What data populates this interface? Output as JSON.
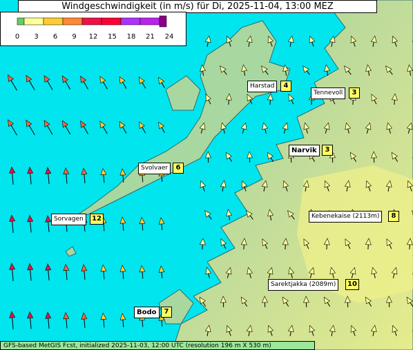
{
  "title": "Windgeschwindigkeit (in m/s) für Di, 2025-11-04, 13:00 MEZ",
  "legend": {
    "ticks": [
      "0",
      "3",
      "6",
      "9",
      "12",
      "15",
      "18",
      "21",
      "24"
    ],
    "colors": [
      "#66cc66",
      "#ffff99",
      "#ffcc33",
      "#ff8833",
      "#ee1144",
      "#ff0033",
      "#aa33ff",
      "#bb22ee",
      "#880088"
    ]
  },
  "footer": "GFS-based MetGIS Fcst, initialized 2025-11-03, 12:00 UTC  (resolution 196 m X 530 m)",
  "places": [
    {
      "name": "Harstad",
      "value": "4",
      "big": false
    },
    {
      "name": "Tennevoll",
      "value": "3",
      "big": false
    },
    {
      "name": "Narvik",
      "value": "3",
      "big": true
    },
    {
      "name": "Svolvaer",
      "value": "6",
      "big": false
    },
    {
      "name": "Kebenekaise (2113m)",
      "value": "8",
      "big": false
    },
    {
      "name": "Sorvagen",
      "value": "12",
      "big": false
    },
    {
      "name": "Sarektjakka (2089m)",
      "value": "10",
      "big": false
    },
    {
      "name": "Bodo",
      "value": "7",
      "big": true
    }
  ],
  "colors": {
    "sea": "#00e5ee",
    "land": "#a8d8a0",
    "highland": "#d8e890",
    "mountain": "#f0f080"
  }
}
